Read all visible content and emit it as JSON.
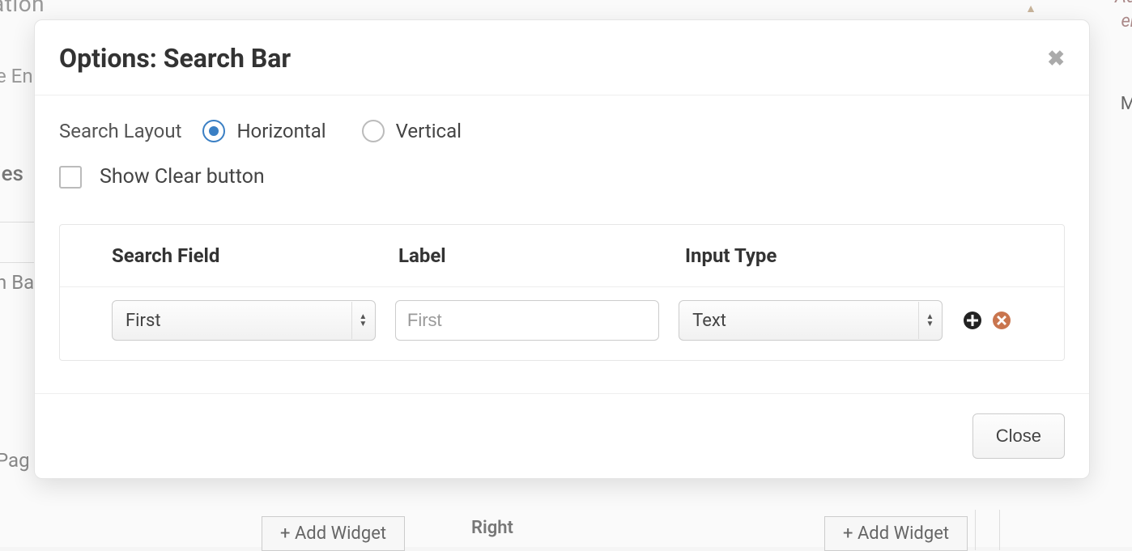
{
  "background": {
    "ation": "ation",
    "e_en": "e En",
    "ies": "ies",
    "n_ba": "n Ba",
    "pag": "Pag",
    "ad": "Ad",
    "er": "er",
    "m": "M",
    "right": "Right",
    "add_widget": "+ Add Widget"
  },
  "modal": {
    "title": "Options: Search Bar",
    "search_layout_label": "Search Layout",
    "layout_options": {
      "horizontal": "Horizontal",
      "vertical": "Vertical"
    },
    "show_clear_label": "Show Clear button",
    "columns": {
      "search_field": "Search Field",
      "label": "Label",
      "input_type": "Input Type"
    },
    "row": {
      "search_field_value": "First",
      "label_placeholder": "First",
      "input_type_value": "Text"
    },
    "close_label": "Close"
  }
}
